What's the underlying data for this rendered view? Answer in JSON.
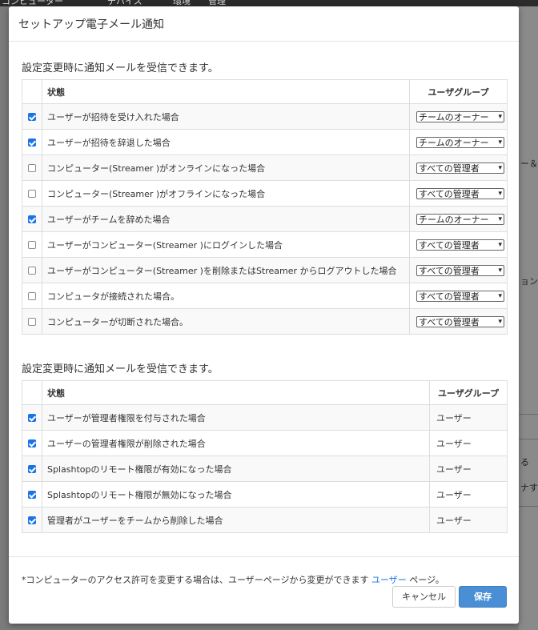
{
  "background": {
    "tabs": [
      "コンピューター",
      "デバイス",
      "環境",
      "管理"
    ],
    "fragments": [
      "ー＆/",
      "ョン服",
      "る",
      "ナする"
    ]
  },
  "dialog": {
    "title": "セットアップ電子メール通知",
    "section1": {
      "heading": "設定変更時に通知メールを受信できます。",
      "col_status": "状態",
      "col_group": "ユーザグループ",
      "rows": [
        {
          "checked": true,
          "label": "ユーザーが招待を受け入れた場合",
          "group": "チームのオーナー"
        },
        {
          "checked": true,
          "label": "ユーザーが招待を辞退した場合",
          "group": "チームのオーナー"
        },
        {
          "checked": false,
          "label": "コンピューター(Streamer )がオンラインになった場合",
          "group": "すべての管理者"
        },
        {
          "checked": false,
          "label": "コンピューター(Streamer )がオフラインになった場合",
          "group": "すべての管理者"
        },
        {
          "checked": true,
          "label": "ユーザーがチームを辞めた場合",
          "group": "チームのオーナー"
        },
        {
          "checked": false,
          "label": "ユーザーがコンピューター(Streamer )にログインした場合",
          "group": "すべての管理者"
        },
        {
          "checked": false,
          "label": "ユーザーがコンピューター(Streamer )を削除またはStreamer からログアウトした場合",
          "group": "すべての管理者"
        },
        {
          "checked": false,
          "label": "コンピュータが接続された場合。",
          "group": "すべての管理者"
        },
        {
          "checked": false,
          "label": "コンピューターが切断された場合。",
          "group": "すべての管理者"
        }
      ]
    },
    "section2": {
      "heading": "設定変更時に通知メールを受信できます。",
      "col_status": "状態",
      "col_group": "ユーザグループ",
      "rows": [
        {
          "checked": true,
          "label": "ユーザーが管理者権限を付与された場合",
          "group": "ユーザー"
        },
        {
          "checked": true,
          "label": "ユーザーの管理者権限が削除された場合",
          "group": "ユーザー"
        },
        {
          "checked": true,
          "label": "Splashtopのリモート権限が有効になった場合",
          "group": "ユーザー"
        },
        {
          "checked": true,
          "label": "Splashtopのリモート権限が無効になった場合",
          "group": "ユーザー"
        },
        {
          "checked": true,
          "label": "管理者がユーザーをチームから削除した場合",
          "group": "ユーザー"
        }
      ]
    },
    "footer": {
      "note": "*コンピューターのアクセス許可を変更する場合は、ユーザーページから変更ができます",
      "link": "ユーザー",
      "note_suffix": " ページ。",
      "cancel_label": "キャンセル",
      "save_label": "保存"
    }
  }
}
